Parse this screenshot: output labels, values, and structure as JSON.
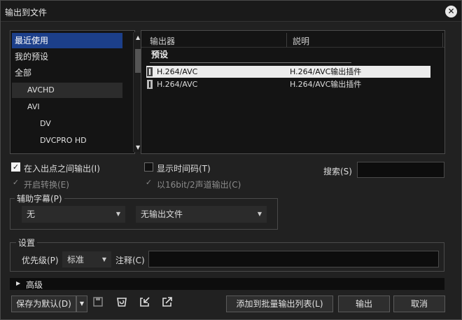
{
  "window": {
    "title": "输出到文件",
    "close_glyph": "✕"
  },
  "categories": [
    {
      "label": "最近使用",
      "selected": true
    },
    {
      "label": "我的预设"
    },
    {
      "label": "全部"
    },
    {
      "label": "AVCHD",
      "indent": 1
    },
    {
      "label": "AVI",
      "indent": 1
    },
    {
      "label": "DV",
      "indent": 2
    },
    {
      "label": "DVCPRO HD",
      "indent": 2
    }
  ],
  "list": {
    "columns": [
      "输出器",
      "説明"
    ],
    "group_label": "预设",
    "rows": [
      {
        "exporter": "H.264/AVC",
        "description": "H.264/AVC输出插件",
        "selected": true
      },
      {
        "exporter": "H.264/AVC",
        "description": "H.264/AVC输出插件"
      }
    ]
  },
  "options": {
    "inout_label": "在入出点之间输出(I)",
    "inout_checked": true,
    "timecode_label": "显示时间码(T)",
    "timecode_checked": false,
    "convert_label": "开启转换(E)",
    "audio16_label": "以16bit/2声道输出(C)",
    "search_label": "搜索(S)",
    "search_value": ""
  },
  "subtitle": {
    "group_label": "辅助字幕(P)",
    "track_value": "无",
    "file_value": "无输出文件"
  },
  "settings": {
    "group_label": "设置",
    "priority_label": "优先级(P)",
    "priority_value": "标准",
    "comment_label": "注释(C)",
    "comment_value": ""
  },
  "advanced": {
    "label": "高级"
  },
  "footer": {
    "save_default": "保存为默认(D)",
    "add_batch": "添加到批量输出列表(L)",
    "export": "输出",
    "cancel": "取消",
    "icons": [
      "save-icon",
      "delete-preset-icon",
      "import-preset-icon",
      "export-preset-icon"
    ]
  }
}
